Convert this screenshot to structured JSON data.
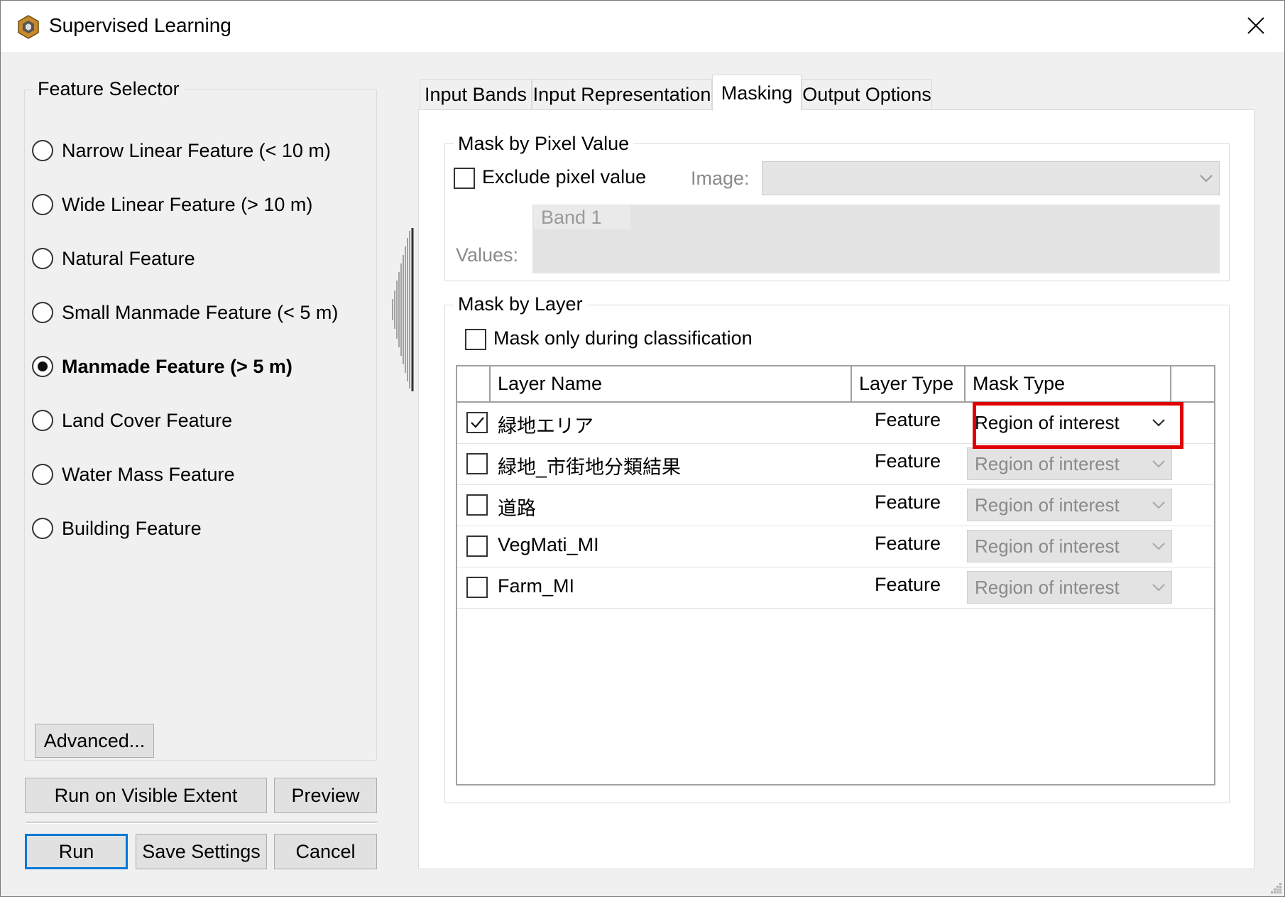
{
  "window": {
    "title": "Supervised Learning",
    "app_icon": "hexagon-app-icon",
    "close_icon": "close-icon"
  },
  "feature_selector": {
    "title": "Feature Selector",
    "options": [
      {
        "label": "Narrow Linear Feature (< 10 m)",
        "selected": false
      },
      {
        "label": "Wide Linear Feature (> 10 m)",
        "selected": false
      },
      {
        "label": "Natural Feature",
        "selected": false
      },
      {
        "label": "Small Manmade Feature (< 5 m)",
        "selected": false
      },
      {
        "label": "Manmade Feature (> 5 m)",
        "selected": true
      },
      {
        "label": "Land Cover Feature",
        "selected": false
      },
      {
        "label": "Water Mass Feature",
        "selected": false
      },
      {
        "label": "Building Feature",
        "selected": false
      }
    ],
    "advanced_label": "Advanced..."
  },
  "actions": {
    "run_visible_label": "Run on Visible Extent",
    "preview_label": "Preview",
    "run_label": "Run",
    "save_settings_label": "Save Settings",
    "cancel_label": "Cancel"
  },
  "tabs": [
    {
      "label": "Input Bands",
      "active": false
    },
    {
      "label": "Input Representation",
      "active": false
    },
    {
      "label": "Masking",
      "active": true
    },
    {
      "label": "Output Options",
      "active": false
    }
  ],
  "mask_by_pixel": {
    "title": "Mask by Pixel Value",
    "exclude_label": "Exclude pixel value",
    "exclude_checked": false,
    "image_label": "Image:",
    "image_value": "",
    "band_column": "Band 1",
    "values_label": "Values:"
  },
  "mask_by_layer": {
    "title": "Mask by Layer",
    "classification_only_label": "Mask only during classification",
    "classification_only_checked": false,
    "columns": {
      "layer_name": "Layer Name",
      "layer_type": "Layer Type",
      "mask_type": "Mask Type"
    },
    "rows": [
      {
        "checked": true,
        "name": "緑地エリア",
        "type": "Feature",
        "mask_type": "Region of interest",
        "enabled": true
      },
      {
        "checked": false,
        "name": "緑地_市街地分類結果",
        "type": "Feature",
        "mask_type": "Region of interest",
        "enabled": false
      },
      {
        "checked": false,
        "name": "道路",
        "type": "Feature",
        "mask_type": "Region of interest",
        "enabled": false
      },
      {
        "checked": false,
        "name": "VegMati_MI",
        "type": "Feature",
        "mask_type": "Region of interest",
        "enabled": false
      },
      {
        "checked": false,
        "name": "Farm_MI",
        "type": "Feature",
        "mask_type": "Region of interest",
        "enabled": false
      }
    ]
  },
  "colors": {
    "window_bg": "#f0f0f0",
    "accent": "#0078d7",
    "highlight": "#e00000",
    "disabled_text": "#8a8a8a"
  }
}
